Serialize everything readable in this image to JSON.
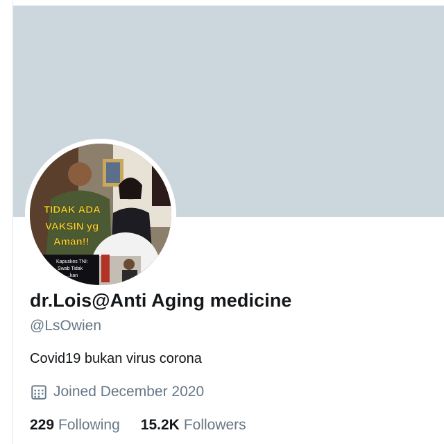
{
  "profile": {
    "display_name": "dr.Lois@Anti Aging medicine",
    "handle": "@LsOwien",
    "bio": "Covid19 bukan virus corona",
    "joined": "Joined December 2020",
    "avatar_overlay_text": [
      "TIDAK ADA",
      "VAKSIN yg",
      "Aman!!"
    ]
  },
  "stats": {
    "following_count": "229",
    "following_label": "Following",
    "followers_count": "15.2K",
    "followers_label": "Followers"
  },
  "colors": {
    "banner": "#ccd6dd",
    "text_primary": "#14171a",
    "text_secondary": "#657786",
    "avatar_text": "#f5d33b"
  },
  "icons": {
    "joined": "calendar-icon"
  }
}
